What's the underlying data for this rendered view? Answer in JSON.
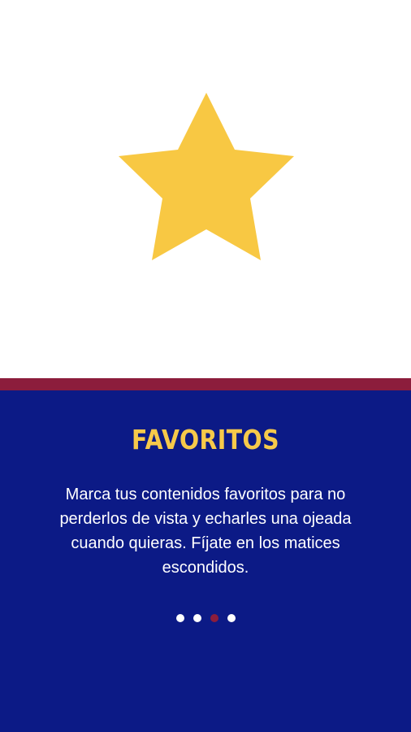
{
  "hero": {
    "icon": "star-icon",
    "icon_color": "#f8c843"
  },
  "colors": {
    "divider": "#8c1d3c",
    "panel": "#0c1a86",
    "title": "#f6c94a",
    "text": "#ffffff"
  },
  "content": {
    "title": "FAVORITOS",
    "description": "Marca tus contenidos favoritos para no perderlos de vista y echarles una ojeada cuando quieras. Fíjate en los matices escondidos."
  },
  "pager": {
    "count": 4,
    "active_index": 2
  }
}
